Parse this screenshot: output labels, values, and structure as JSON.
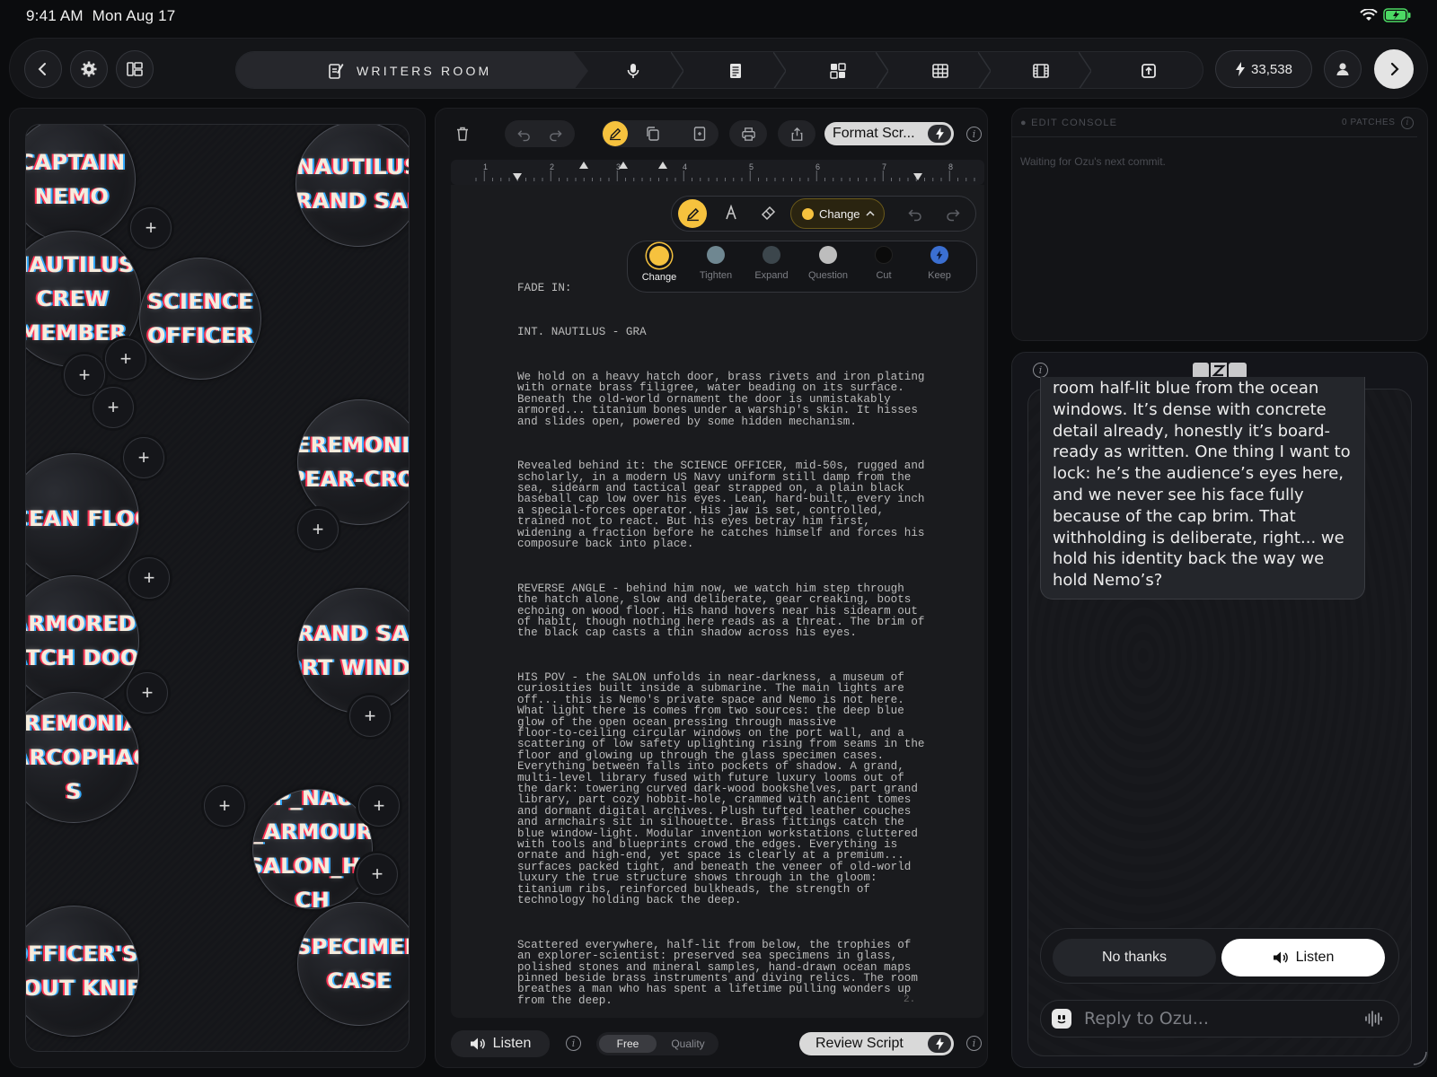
{
  "status_bar": {
    "time": "9:41 AM",
    "date": "Mon Aug 17"
  },
  "top_bar": {
    "pipeline_title": "WRITERS ROOM",
    "steps": [
      "microphone-icon",
      "document-icon",
      "storyboard-icon",
      "grid-icon",
      "filmstrip-icon",
      "upload-icon"
    ],
    "credits": "33,538"
  },
  "board": {
    "bubbles": [
      "CAPTAIN\nNEMO",
      "NAUTILUS\nGRAND SALO",
      "NAUTILUS\nCREW\nMEMBER",
      "SCIENCE\nOFFICER",
      "CEREMONIAL\nSPEAR-CROSS",
      "OCEAN FLOO",
      "ARMORED\nHATCH DOOR",
      "GRAND SALO\nPORT WINDOW",
      "CEREMONIAL\nSARCOPHAG\nS",
      "OP_NAUT\nS_ARMOURE\nSALON_HA\nCH",
      "OFFICER'S\nSCOUT KNIFE",
      "SPECIMEN\nCASE"
    ]
  },
  "editor": {
    "format_button": "Format Scr...",
    "annotate_mode": "Change",
    "palette": [
      {
        "label": "Change",
        "color": "#f6c23e"
      },
      {
        "label": "Tighten",
        "color": "#6f8791"
      },
      {
        "label": "Expand",
        "color": "#3c464c"
      },
      {
        "label": "Question",
        "color": "#bdbdbd"
      },
      {
        "label": "Cut",
        "color": "#0b0b0b"
      },
      {
        "label": "Keep",
        "color": "#3b6fd1"
      }
    ],
    "ruler_numbers": [
      "1",
      "2",
      "3",
      "4",
      "5",
      "6",
      "7",
      "8"
    ],
    "script": {
      "fade_in": "FADE IN:",
      "slugline": "INT. NAUTILUS - GRA",
      "paragraphs": [
        "We hold on a heavy hatch door, brass rivets and iron plating\nwith ornate brass filigree, water beading on its surface.\nBeneath the old-world ornament the door is unmistakably\narmored... titanium bones under a warship's skin. It hisses\nand slides open, powered by some hidden mechanism.",
        "Revealed behind it: the SCIENCE OFFICER, mid-50s, rugged and\nscholarly, in a modern US Navy uniform still damp from the\nsea, sidearm and tactical gear strapped on, a plain black\nbaseball cap low over his eyes. Lean, hard-built, every inch\na special-forces operator. His jaw is set, controlled,\ntrained not to react. But his eyes betray him first,\nwidening a fraction before he catches himself and forces his\ncomposure back into place.",
        "REVERSE ANGLE - behind him now, we watch him step through\nthe hatch alone, slow and deliberate, gear creaking, boots\nechoing on wood floor. His hand hovers near his sidearm out\nof habit, though nothing here reads as a threat. The brim of\nthe black cap casts a thin shadow across his eyes.",
        "HIS POV - the SALON unfolds in near-darkness, a museum of\ncuriosities built inside a submarine. The main lights are\noff... this is Nemo's private space and Nemo is not here.\nWhat light there is comes from two sources: the deep blue\nglow of the open ocean pressing through massive\nfloor-to-ceiling circular windows on the port wall, and a\nscattering of low safety uplighting rising from seams in the\nfloor and glowing up through the glass specimen cases.\nEverything between falls into pockets of shadow. A grand,\nmulti-level library fused with future luxury looms out of\nthe dark: towering curved dark-wood bookshelves, part grand\nlibrary, part cozy hobbit-hole, crammed with ancient tomes\nand dormant digital archives. Plush tufted leather couches\nand armchairs sit in silhouette. Brass fittings catch the\nblue window-light. Modular invention workstations cluttered\nwith tools and blueprints crowd the edges. Everything is\nornate and high-end, yet space is clearly at a premium...\nsurfaces packed tight, and beneath the veneer of old-world\nluxury the true structure shows through in the gloom:\ntitanium ribs, reinforced bulkheads, the strength of\ntechnology holding back the deep.",
        "Scattered everywhere, half-lit from below, the trophies of\nan explorer-scientist: preserved sea specimens in glass,\npolished stones and mineral samples, hand-drawn ocean maps\npinned beside brass instruments and diving relics. The room\nbreathes a man who has spent a lifetime pulling wonders up\nfrom the deep."
      ],
      "page_number": "2."
    },
    "bottom": {
      "listen": "Listen",
      "mode_free": "Free",
      "mode_quality": "Quality",
      "review": "Review Script"
    }
  },
  "console": {
    "title": "EDIT CONSOLE",
    "patches": "0 PATCHES",
    "status": "Waiting for Ozu's next commit."
  },
  "chat": {
    "message": "room half-lit blue from the ocean windows. It’s dense with concrete detail already, honestly it’s board-ready as written. One thing I want to lock: he’s the audience’s eyes here, and we never see his face fully because of the cap brim. That withholding is deliberate, right... we hold his identity back the way we hold Nemo’s?",
    "no_thanks": "No thanks",
    "listen": "Listen",
    "reply_placeholder": "Reply to Ozu..."
  },
  "colors": {
    "accent_yellow": "#f6c23e",
    "background": "#0b0c0e",
    "panel": "#131417"
  }
}
